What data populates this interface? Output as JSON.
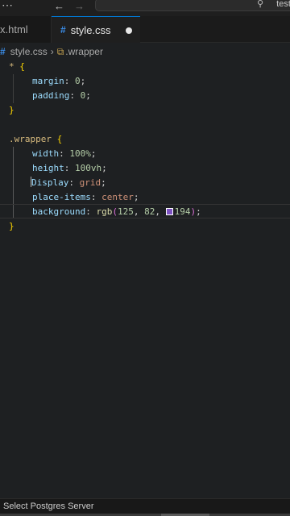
{
  "titlebar": {
    "menu_icon": "more-dots-icon",
    "back_icon": "arrow-left-icon",
    "forward_icon": "arrow-right-icon",
    "search_icon": "search-icon",
    "search_text": "testh"
  },
  "tabs": [
    {
      "label": "x.html"
    },
    {
      "label": "style.css",
      "dirty": true
    }
  ],
  "breadcrumb": {
    "file": "style.css",
    "symbol": ".wrapper"
  },
  "code": {
    "line1_selector": "*",
    "line1_open": "{",
    "line2_prop": "margin",
    "line2_value": "0",
    "line3_prop": "padding",
    "line3_value": "0",
    "line4_close": "}",
    "line6_selector": ".wrapper",
    "line6_open": "{",
    "line7_prop": "width",
    "line7_num": "100",
    "line7_unit": "%",
    "line8_prop": "height",
    "line8_num": "100",
    "line8_unit": "vh",
    "line9_prop_d": "D",
    "line9_prop_rest": "isplay",
    "line9_value": "grid",
    "line10_prop": "place-items",
    "line10_value": "center",
    "line11_prop": "background",
    "line11_fn": "rgb",
    "line11_a": "125",
    "line11_b": "82",
    "line11_c": "194",
    "line12_close": "}"
  },
  "colors": {
    "swatch": "#7d52c2",
    "accent": "#0078d4"
  },
  "statusbar": {
    "text": "Select Postgres Server"
  }
}
